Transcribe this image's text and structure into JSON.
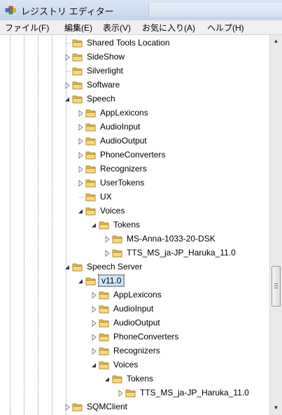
{
  "window": {
    "title": "レジストリ エディター"
  },
  "menu": [
    "ファイル(F)",
    "編集(E)",
    "表示(V)",
    "お気に入り(A)",
    "ヘルプ(H)"
  ],
  "colors": {
    "folder": "#e9b83c",
    "selection": "#cde6fb",
    "title_bg": "#c4d5ea"
  },
  "tree": [
    {
      "label": "Shared Tools Location",
      "depth": 0,
      "state": "leaf"
    },
    {
      "label": "SideShow",
      "depth": 0,
      "state": "collapsed"
    },
    {
      "label": "Silverlight",
      "depth": 0,
      "state": "leaf"
    },
    {
      "label": "Software",
      "depth": 0,
      "state": "collapsed"
    },
    {
      "label": "Speech",
      "depth": 0,
      "state": "expanded"
    },
    {
      "label": "AppLexicons",
      "depth": 1,
      "state": "collapsed"
    },
    {
      "label": "AudioInput",
      "depth": 1,
      "state": "collapsed"
    },
    {
      "label": "AudioOutput",
      "depth": 1,
      "state": "collapsed"
    },
    {
      "label": "PhoneConverters",
      "depth": 1,
      "state": "collapsed"
    },
    {
      "label": "Recognizers",
      "depth": 1,
      "state": "collapsed"
    },
    {
      "label": "UserTokens",
      "depth": 1,
      "state": "collapsed"
    },
    {
      "label": "UX",
      "depth": 1,
      "state": "leaf"
    },
    {
      "label": "Voices",
      "depth": 1,
      "state": "expanded"
    },
    {
      "label": "Tokens",
      "depth": 2,
      "state": "expanded"
    },
    {
      "label": "MS-Anna-1033-20-DSK",
      "depth": 3,
      "state": "collapsed"
    },
    {
      "label": "TTS_MS_ja-JP_Haruka_11.0",
      "depth": 3,
      "state": "collapsed"
    },
    {
      "label": "Speech Server",
      "depth": 0,
      "state": "expanded"
    },
    {
      "label": "v11.0",
      "depth": 1,
      "state": "expanded",
      "selected": true
    },
    {
      "label": "AppLexicons",
      "depth": 2,
      "state": "collapsed"
    },
    {
      "label": "AudioInput",
      "depth": 2,
      "state": "collapsed"
    },
    {
      "label": "AudioOutput",
      "depth": 2,
      "state": "collapsed"
    },
    {
      "label": "PhoneConverters",
      "depth": 2,
      "state": "collapsed"
    },
    {
      "label": "Recognizers",
      "depth": 2,
      "state": "collapsed"
    },
    {
      "label": "Voices",
      "depth": 2,
      "state": "expanded"
    },
    {
      "label": "Tokens",
      "depth": 3,
      "state": "expanded"
    },
    {
      "label": "TTS_MS_ja-JP_Haruka_11.0",
      "depth": 4,
      "state": "collapsed"
    },
    {
      "label": "SQMClient",
      "depth": 0,
      "state": "collapsed"
    }
  ]
}
